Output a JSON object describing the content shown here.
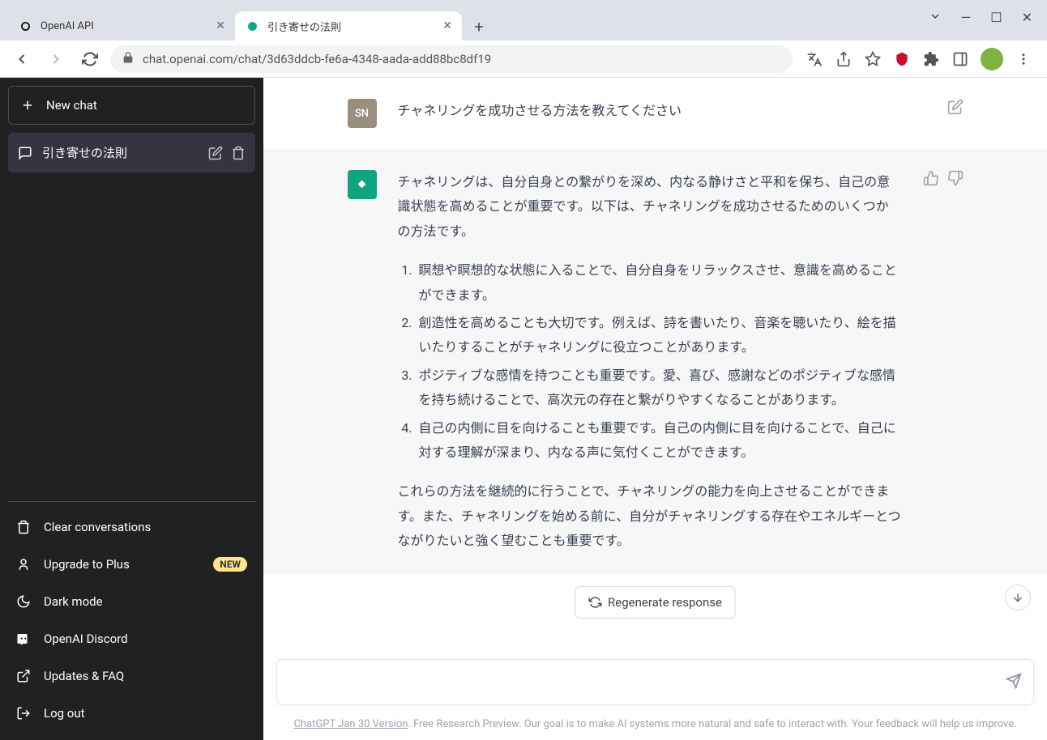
{
  "browser": {
    "tabs": [
      {
        "title": "OpenAI API"
      },
      {
        "title": "引き寄せの法則"
      }
    ],
    "url": "chat.openai.com/chat/3d63ddcb-fe6a-4348-aada-add88bc8df19"
  },
  "sidebar": {
    "new_chat": "New chat",
    "conversations": [
      {
        "title": "引き寄せの法則"
      }
    ],
    "links": {
      "clear": "Clear conversations",
      "upgrade": "Upgrade to Plus",
      "upgrade_badge": "NEW",
      "dark_mode": "Dark mode",
      "discord": "OpenAI Discord",
      "faq": "Updates & FAQ",
      "logout": "Log out"
    }
  },
  "chat": {
    "user_avatar": "SN",
    "user_message": "チャネリングを成功させる方法を教えてください",
    "assistant_intro": "チャネリングは、自分自身との繋がりを深め、内なる静けさと平和を保ち、自己の意識状態を高めることが重要です。以下は、チャネリングを成功させるためのいくつかの方法です。",
    "assistant_list": [
      "瞑想や瞑想的な状態に入ることで、自分自身をリラックスさせ、意識を高めることができます。",
      "創造性を高めることも大切です。例えば、詩を書いたり、音楽を聴いたり、絵を描いたりすることがチャネリングに役立つことがあります。",
      "ポジティブな感情を持つことも重要です。愛、喜び、感謝などのポジティブな感情を持ち続けることで、高次元の存在と繋がりやすくなることがあります。",
      "自己の内側に目を向けることも重要です。自己の内側に目を向けることで、自己に対する理解が深まり、内なる声に気付くことができます。"
    ],
    "assistant_outro": "これらの方法を継続的に行うことで、チャネリングの能力を向上させることができます。また、チャネリングを始める前に、自分がチャネリングする存在やエネルギーとつながりたいと強く望むことも重要です。",
    "regenerate": "Regenerate response"
  },
  "footer": {
    "version": "ChatGPT Jan 30 Version",
    "text": ". Free Research Preview. Our goal is to make AI systems more natural and safe to interact with. Your feedback will help us improve."
  }
}
